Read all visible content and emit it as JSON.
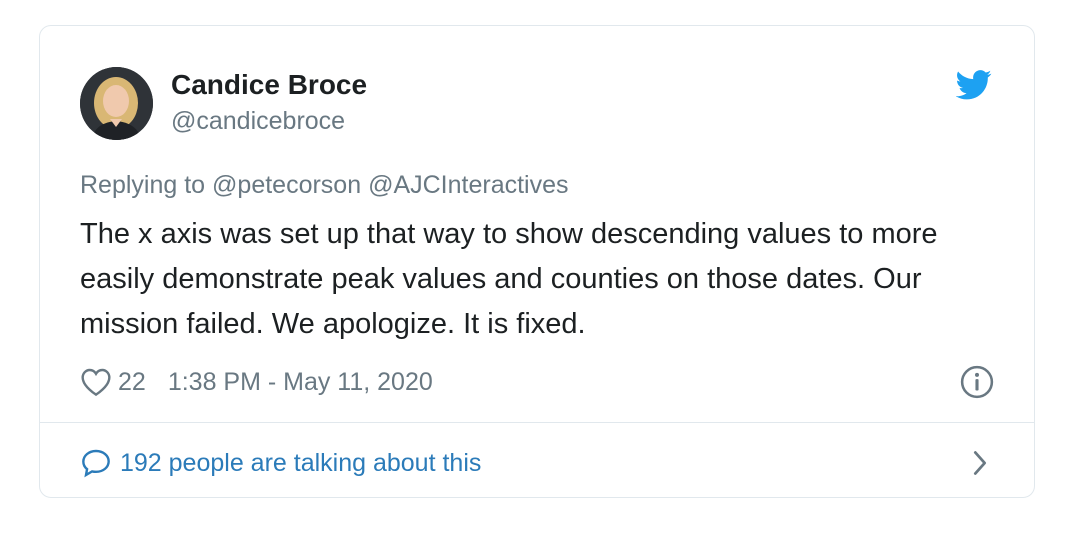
{
  "tweet": {
    "author_name": "Candice Broce",
    "author_handle": "@candicebroce",
    "replying_label": "Replying to",
    "reply_mentions": [
      "@petecorson",
      "@AJCInteractives"
    ],
    "text": "The x axis was set up that way to show descending values to more easily demonstrate peak values and counties on those dates. Our mission failed. We apologize. It is fixed.",
    "likes": "22",
    "timestamp": "1:38 PM - May 11, 2020",
    "conversation_label": "192 people are talking about this"
  },
  "icons": {
    "brand": "twitter-bird-icon",
    "like": "heart-icon",
    "info": "info-icon",
    "conversation": "speech-bubble-icon",
    "navigate": "chevron-right-icon"
  },
  "colors": {
    "twitter_blue": "#1da1f2",
    "link_blue": "#2b7bb9",
    "muted_text": "#697882",
    "body_text": "#1c2022",
    "border": "#e1e8ed"
  }
}
